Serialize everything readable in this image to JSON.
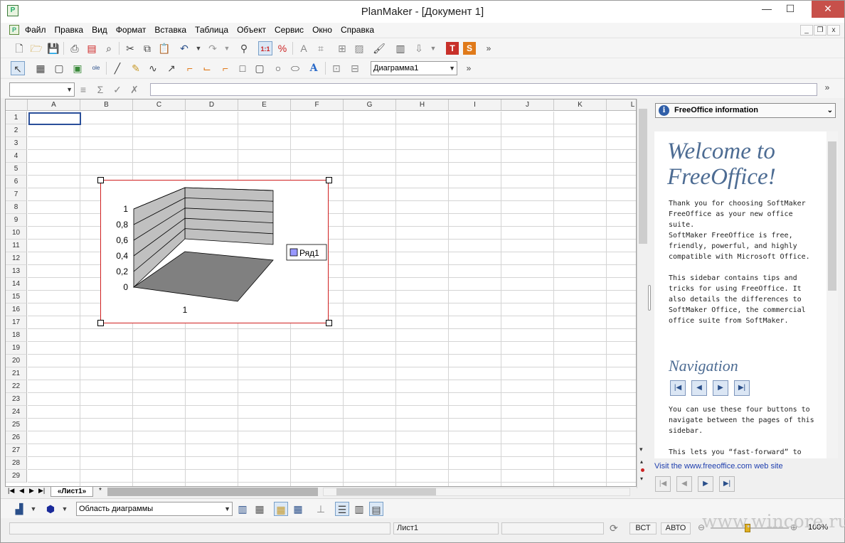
{
  "window": {
    "title": "PlanMaker - [Документ 1]",
    "app_icon": "planmaker-icon"
  },
  "window_controls": {
    "minimize": "—",
    "maximize": "☐",
    "close": "✕"
  },
  "mdi_controls": {
    "minimize": "_",
    "restore": "❐",
    "close": "x"
  },
  "menu": {
    "items": [
      "Файл",
      "Правка",
      "Вид",
      "Формат",
      "Вставка",
      "Таблица",
      "Объект",
      "Сервис",
      "Окно",
      "Справка"
    ]
  },
  "toolbar": {
    "chart_object_combo": "Диаграмма1",
    "more": "»"
  },
  "formula_bar": {
    "cell_ref": "",
    "formula": ""
  },
  "sheet": {
    "columns": [
      "A",
      "B",
      "C",
      "D",
      "E",
      "F",
      "G",
      "H",
      "I",
      "J",
      "K",
      "L"
    ],
    "rows": [
      "1",
      "2",
      "3",
      "4",
      "5",
      "6",
      "7",
      "8",
      "9",
      "10",
      "11",
      "12",
      "13",
      "14",
      "15",
      "16",
      "17",
      "18",
      "19",
      "20",
      "21",
      "22",
      "23",
      "24",
      "25",
      "26",
      "27",
      "28",
      "29"
    ],
    "selected_cell": "A1"
  },
  "chart_data": {
    "type": "bar",
    "variant": "3d-column",
    "categories": [
      "1"
    ],
    "series": [
      {
        "name": "Ряд1",
        "values": [
          0
        ]
      }
    ],
    "yticks": [
      "1",
      "0,8",
      "0,6",
      "0,4",
      "0,2",
      "0"
    ],
    "ylim": [
      0,
      1
    ],
    "legend": "right",
    "wall_color": "#c0c0c0",
    "floor_color": "#808080",
    "selection_border_color": "#d02020"
  },
  "sheet_tabs": {
    "active": "«Лист1»",
    "new": "*"
  },
  "bottom_toolbar": {
    "chart_element_combo": "Область диаграммы"
  },
  "status": {
    "sheet": "Лист1",
    "insert_mode": "ВСТ",
    "auto_mode": "АВТО",
    "zoom": "100%"
  },
  "sidebar": {
    "header": "FreeOffice information",
    "welcome": "Welcome to FreeOffice!",
    "paragraphs": [
      "Thank you for choosing SoftMaker FreeOffice as your new office suite.",
      "SoftMaker FreeOffice is free, friendly, powerful, and highly compatible with Microsoft Office.",
      "This sidebar contains tips and tricks for using FreeOffice. It also details the differences to SoftMaker Office, the commercial office suite from SoftMaker."
    ],
    "nav_title": "Navigation",
    "nav_text": "You can use these four buttons to navigate between the pages of this sidebar.",
    "nav_text2": "This lets you “fast-forward” to",
    "link": "Visit the www.freeoffice.com web site"
  },
  "watermark": "www.wincore.ru"
}
